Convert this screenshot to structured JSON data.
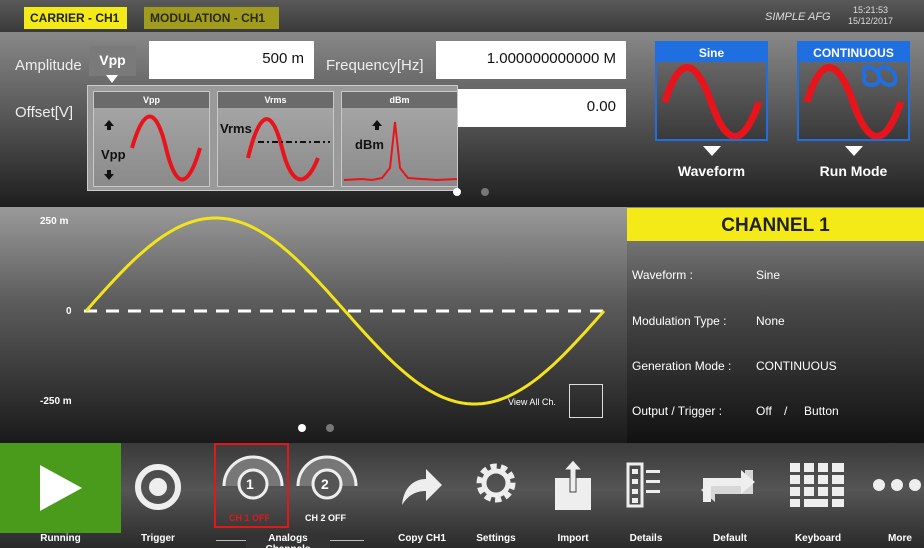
{
  "tabs": {
    "carrier": "CARRIER - CH1",
    "modulation": "MODULATION - CH1"
  },
  "app_title": "SIMPLE AFG",
  "clock": {
    "time": "15:21:53",
    "date": "15/12/2017"
  },
  "carrier": {
    "amplitude_label": "Amplitude",
    "amplitude_unit": "Vpp",
    "amplitude_value": "500 m",
    "frequency_label": "Frequency[Hz]",
    "frequency_value": "1.000000000000 M",
    "offset_label": "Offset[V]",
    "offset_value": "0.00"
  },
  "amp_dropdown": [
    {
      "head": "Vpp",
      "label": "Vpp"
    },
    {
      "head": "Vrms",
      "label": "Vrms"
    },
    {
      "head": "dBm",
      "label": "dBm"
    }
  ],
  "waveform": {
    "header": "Sine",
    "label": "Waveform"
  },
  "run_mode": {
    "header": "CONTINUOUS",
    "label": "Run Mode"
  },
  "plot": {
    "y_top": "250 m",
    "y_zero": "0",
    "y_bottom": "-250 m",
    "view_all": "View All Ch.",
    "wave_color": "#f3e31a"
  },
  "channel": {
    "title": "CHANNEL 1",
    "rows": [
      {
        "key": "Waveform :",
        "value": "Sine"
      },
      {
        "key": "Modulation Type :",
        "value": "None"
      },
      {
        "key": "Generation Mode :",
        "value": "CONTINUOUS"
      },
      {
        "key": "Output / Trigger :",
        "value": "Off",
        "value2": "Button"
      }
    ]
  },
  "toolbar": {
    "running": "Running",
    "trigger": "Trigger",
    "analog_channels": "Analogs Channels",
    "ch1_num": "1",
    "ch1_state": "CH 1 OFF",
    "ch2_num": "2",
    "ch2_state": "CH 2 OFF",
    "copy": "Copy CH1",
    "settings": "Settings",
    "import": "Import",
    "details": "Details",
    "default": "Default",
    "keyboard": "Keyboard",
    "more": "More"
  },
  "colors": {
    "accent_yellow": "#f3ea18",
    "mode_blue": "#1f6fe0",
    "run_green": "#4a9a1c",
    "ch1_red": "#e01818",
    "sine_red": "#e8141c"
  }
}
